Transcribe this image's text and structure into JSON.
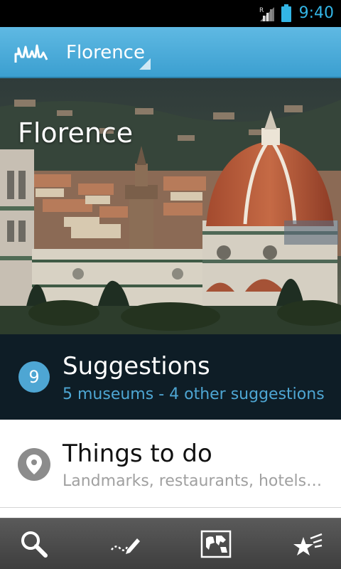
{
  "status_bar": {
    "time": "9:40",
    "roaming_indicator": "R"
  },
  "action_bar": {
    "city": "Florence",
    "app_icon": "skyline-icon"
  },
  "hero": {
    "title": "Florence"
  },
  "suggestions": {
    "count": "9",
    "title": "Suggestions",
    "subtitle": "5 museums - 4 other suggestions"
  },
  "things_to_do": {
    "title": "Things to do",
    "subtitle": "Landmarks, restaurants, hotels …",
    "icon": "map-pin-icon"
  },
  "bottom_bar": {
    "icons": [
      "search-icon",
      "trail-pen-icon",
      "world-map-icon",
      "stars-icon"
    ]
  },
  "colors": {
    "accent": "#33b5e5",
    "action_bar": "#4aa9d7",
    "suggestions_bg": "#0e1d26",
    "suggestions_sub": "#4ea6d3",
    "bottom_bar": "#4a4a4a"
  }
}
